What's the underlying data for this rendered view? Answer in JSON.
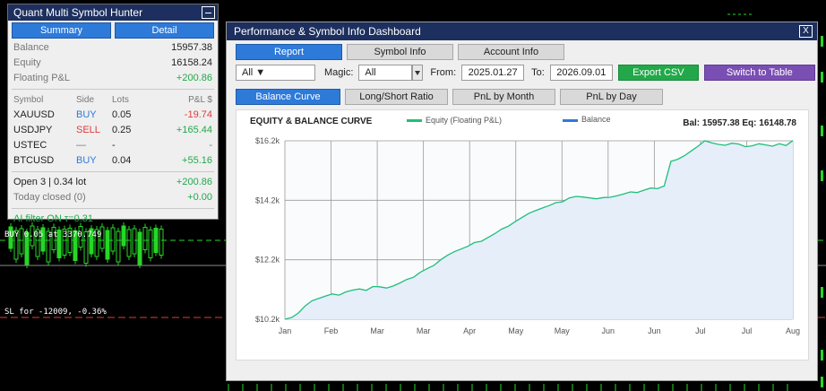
{
  "background": {
    "buy_label": "BUY 0.05 at 3370.749",
    "sl_label": "SL for -12009, -0.36%"
  },
  "hunter": {
    "title": "Quant Multi Symbol Hunter",
    "tabs": [
      {
        "label": "Summary"
      },
      {
        "label": "Detail"
      }
    ],
    "metrics": [
      {
        "key": "Balance",
        "value": "15957.38"
      },
      {
        "key": "Equity",
        "value": "16158.24"
      },
      {
        "key": "Floating P&L",
        "value": "+200.86"
      }
    ],
    "columns": {
      "symbol": "Symbol",
      "side": "Side",
      "lots": "Lots",
      "pnl": "P&L $"
    },
    "positions": [
      {
        "symbol": "XAUUSD",
        "side": "BUY",
        "lots": "0.05",
        "pnl": "-19.74"
      },
      {
        "symbol": "USDJPY",
        "side": "SELL",
        "lots": "0.25",
        "pnl": "+165.44"
      },
      {
        "symbol": "USTEC",
        "side": "—",
        "lots": "-",
        "pnl": "-"
      },
      {
        "symbol": "BTCUSD",
        "side": "BUY",
        "lots": "0.04",
        "pnl": "+55.16"
      }
    ],
    "open_summary": {
      "label": "Open 3 | 0.34 lot",
      "value": "+200.86"
    },
    "closed_summary": {
      "label": "Today closed (0)",
      "value": "+0.00"
    },
    "ai_filter": "AI filter ON  τ=0.31"
  },
  "dashboard": {
    "title": "Performance & Symbol Info Dashboard",
    "close_glyph": "X",
    "tabs": [
      {
        "label": "Report"
      },
      {
        "label": "Symbol Info"
      },
      {
        "label": "Account Info"
      }
    ],
    "filters": {
      "symbol_value": "All ▼",
      "magic_label": "Magic:",
      "magic_value": "All",
      "from_label": "From:",
      "from_value": "2025.01.27",
      "to_label": "To:",
      "to_value": "2026.09.01",
      "export_label": "Export CSV",
      "switch_label": "Switch to Table"
    },
    "chart_tabs": [
      {
        "label": "Balance Curve"
      },
      {
        "label": "Long/Short Ratio"
      },
      {
        "label": "PnL by Month"
      },
      {
        "label": "PnL by Day"
      }
    ],
    "accent_blue": "#2d7ad9",
    "accent_green": "#22a84a",
    "accent_purple": "#7a4fb4"
  },
  "chart_data": {
    "type": "area",
    "title": "EQUITY & BALANCE CURVE",
    "stats": "Bal: 15957.38  Eq: 16148.78",
    "legend_placement": "top",
    "grid": true,
    "y_ticks": [
      {
        "label": "$16.2k",
        "value": 16200
      },
      {
        "label": "$14.2k",
        "value": 14200
      },
      {
        "label": "$12.2k",
        "value": 12200
      },
      {
        "label": "$10.2k",
        "value": 10200
      }
    ],
    "ylim": [
      10200,
      16200
    ],
    "x_ticks": [
      "Jan",
      "Feb",
      "Mar",
      "Mar",
      "Apr",
      "May",
      "May",
      "Jun",
      "Jun",
      "Jul",
      "Jul",
      "Aug"
    ],
    "series": [
      {
        "name": "Equity (Floating P&L)",
        "color": "#1fbf7a",
        "values": [
          10200,
          10260,
          10410,
          10650,
          10820,
          10900,
          10980,
          11050,
          11010,
          11120,
          11180,
          11220,
          11170,
          11300,
          11290,
          11250,
          11320,
          11420,
          11540,
          11610,
          11780,
          11900,
          12010,
          12200,
          12350,
          12470,
          12560,
          12650,
          12780,
          12820,
          12950,
          13080,
          13230,
          13330,
          13480,
          13620,
          13760,
          13850,
          13940,
          14020,
          14120,
          14150,
          14280,
          14330,
          14310,
          14280,
          14250,
          14290,
          14300,
          14350,
          14410,
          14480,
          14460,
          14540,
          14610,
          14590,
          14680,
          15510,
          15580,
          15700,
          15860,
          16020,
          16200,
          16130,
          16080,
          16050,
          16120,
          16090,
          16000,
          16030,
          16100,
          16060,
          16020,
          16100,
          16040,
          16210
        ]
      },
      {
        "name": "Balance",
        "color": "#2d7ad9",
        "values": []
      }
    ]
  }
}
